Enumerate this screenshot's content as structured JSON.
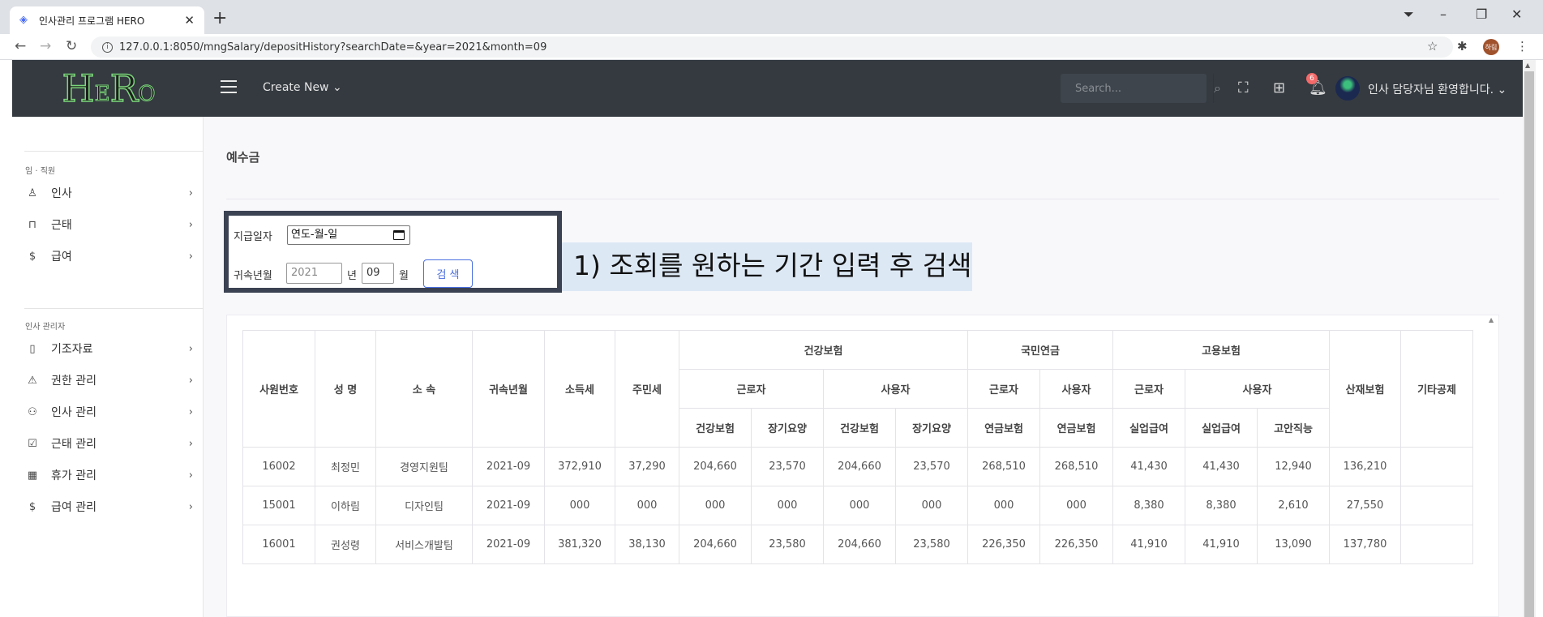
{
  "browser": {
    "tab_title": "인사관리 프로그램 HERO",
    "tab_close": "✕",
    "new_tab": "+",
    "url": "127.0.0.1:8050/mngSalary/depositHistory?searchDate=&year=2021&month=09",
    "profile_initials": "하림"
  },
  "header": {
    "logo_h": "H",
    "logo_e": "E",
    "logo_r": "R",
    "logo_o": "O",
    "create_new": "Create New ⌄",
    "search_placeholder": "Search...",
    "notification_count": "6",
    "welcome": "인사 담당자님 환영합니다. ⌄"
  },
  "sidebar": {
    "section1": "임 · 직원",
    "section2": "인사 관리자",
    "items1": [
      {
        "label": "인사",
        "icon": "user-icon"
      },
      {
        "label": "근태",
        "icon": "briefcase-icon"
      },
      {
        "label": "급여",
        "icon": "dollar-icon"
      }
    ],
    "items2": [
      {
        "label": "기조자료",
        "icon": "clipboard-icon"
      },
      {
        "label": "권한 관리",
        "icon": "alert-triangle-icon"
      },
      {
        "label": "인사 관리",
        "icon": "users-icon"
      },
      {
        "label": "근태 관리",
        "icon": "check-square-icon"
      },
      {
        "label": "휴가 관리",
        "icon": "calendar-icon"
      },
      {
        "label": "급여 관리",
        "icon": "dollar-icon"
      }
    ]
  },
  "page": {
    "title": "예수금",
    "pay_date_label": "지급일자",
    "pay_date_value": "연도-월-일",
    "belong_label": "귀속년월",
    "year_placeholder": "2021",
    "year_unit": "년",
    "month_value": "09",
    "month_unit": "월",
    "search_button": "검 색",
    "annotation": "1) 조회를 원하는 기간 입력 후 검색"
  },
  "table": {
    "h": {
      "emp_no": "사원번호",
      "name": "성 명",
      "dept": "소 속",
      "belong_month": "귀속년월",
      "income_tax": "소득세",
      "resident_tax": "주민세",
      "health": "건강보험",
      "pension": "국민연금",
      "employment": "고용보험",
      "industrial": "산재보험",
      "other": "기타공제",
      "worker": "근로자",
      "employer": "사용자",
      "health_ins": "건강보험",
      "long_term": "장기요양",
      "pension_ins": "연금보험",
      "unemployment": "실업급여",
      "stability": "고안직능"
    },
    "rows": [
      [
        "16002",
        "최정민",
        "경영지원팀",
        "2021-09",
        "372,910",
        "37,290",
        "204,660",
        "23,570",
        "204,660",
        "23,570",
        "268,510",
        "268,510",
        "41,430",
        "41,430",
        "12,940",
        "136,210",
        ""
      ],
      [
        "15001",
        "이하림",
        "디자인팀",
        "2021-09",
        "000",
        "000",
        "000",
        "000",
        "000",
        "000",
        "000",
        "000",
        "8,380",
        "8,380",
        "2,610",
        "27,550",
        ""
      ],
      [
        "16001",
        "권성령",
        "서비스개발팀",
        "2021-09",
        "381,320",
        "38,130",
        "204,660",
        "23,580",
        "204,660",
        "23,580",
        "226,350",
        "226,350",
        "41,910",
        "41,910",
        "13,090",
        "137,780",
        ""
      ]
    ]
  }
}
